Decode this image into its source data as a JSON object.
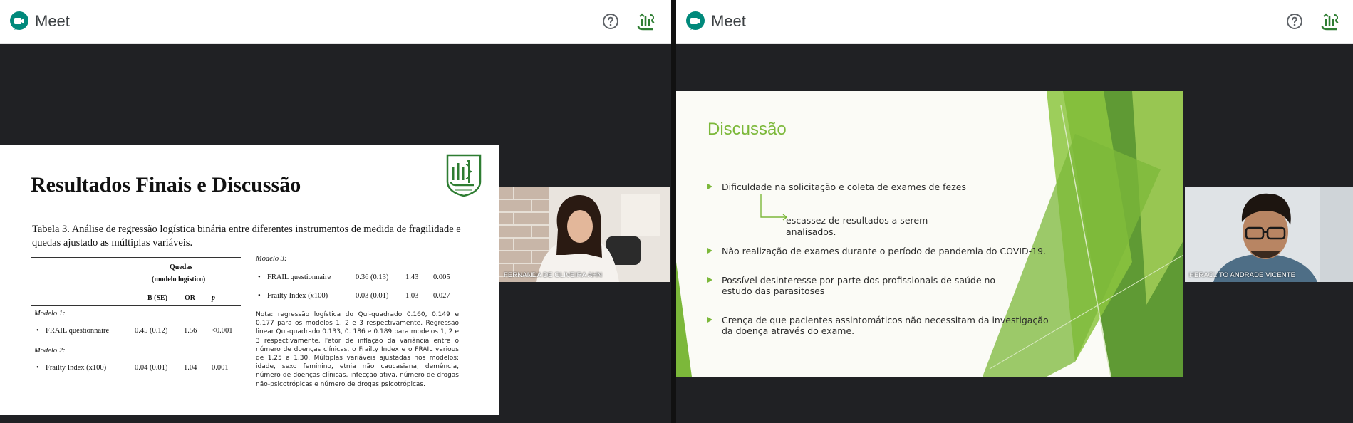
{
  "left_window": {
    "app_title": "Meet",
    "slide": {
      "title": "Resultados Finais e Discussão",
      "caption": "Tabela 3. Análise de regressão logística binária entre diferentes instrumentos de medida de fragilidade e quedas ajustado as múltiplas variáveis.",
      "table": {
        "group_header_line1": "Quedas",
        "group_header_line2": "(modelo logístico)",
        "col_headers": [
          "B (SE)",
          "OR",
          "p"
        ],
        "model1_label": "Modelo 1:",
        "model1_row": [
          "FRAIL questionnaire",
          "0.45 (0.12)",
          "1.56",
          "<0.001"
        ],
        "model2_label": "Modelo 2:",
        "model2_row": [
          "Frailty Index (x100)",
          "0.04 (0.01)",
          "1.04",
          "0.001"
        ],
        "model3_label": "Modelo 3:",
        "model3_rows": [
          [
            "FRAIL questionnaire",
            "0.36 (0.13)",
            "1.43",
            "0.005"
          ],
          [
            "Frailty Index (x100)",
            "0.03 (0.01)",
            "1.03",
            "0.027"
          ]
        ]
      },
      "note": "Nota: regressão logística do Qui-quadrado 0.160, 0.149 e 0.177 para os modelos 1, 2 e 3 respectivamente. Regressão linear Qui-quadrado 0.133, 0. 186 e 0.189 para modelos 1, 2 e 3 respectivamente. Fator de inflação da variância entre o número de doenças clínicas, o Frailty Index e o FRAIL various de 1.25 a 1.30. Múltiplas variáveis ajustadas nos modelos: idade, sexo feminino, etnia não caucasiana, demência, número de doenças clínicas, infecção ativa, número de drogas não-psicotrópicas e número de drogas psicotrópicas."
    },
    "participant_name": "FERNANDA DE OLIVEIRA AHN"
  },
  "right_window": {
    "app_title": "Meet",
    "slide": {
      "title": "Discussão",
      "bullets": [
        "Dificuldade na solicitação e coleta de exames de fezes",
        "Não realização de exames durante o período de pandemia do COVID-19.",
        "Possível desinteresse por parte dos profissionais de saúde no estudo das parasitoses",
        "Crença de que pacientes assintomáticos não necessitam da investigação da doença através do exame."
      ],
      "sub_point_line1": "escassez de resultados a serem",
      "sub_point_line2": "analisados."
    },
    "participant_name": "HERACLITO ANDRADE VICENTE"
  },
  "icons": {
    "meet_logo": "meet-logo-icon",
    "help": "help-icon",
    "brand": "brand-icon"
  },
  "colors": {
    "accent_green": "#7cb83a",
    "meet_teal": "#00897b"
  }
}
